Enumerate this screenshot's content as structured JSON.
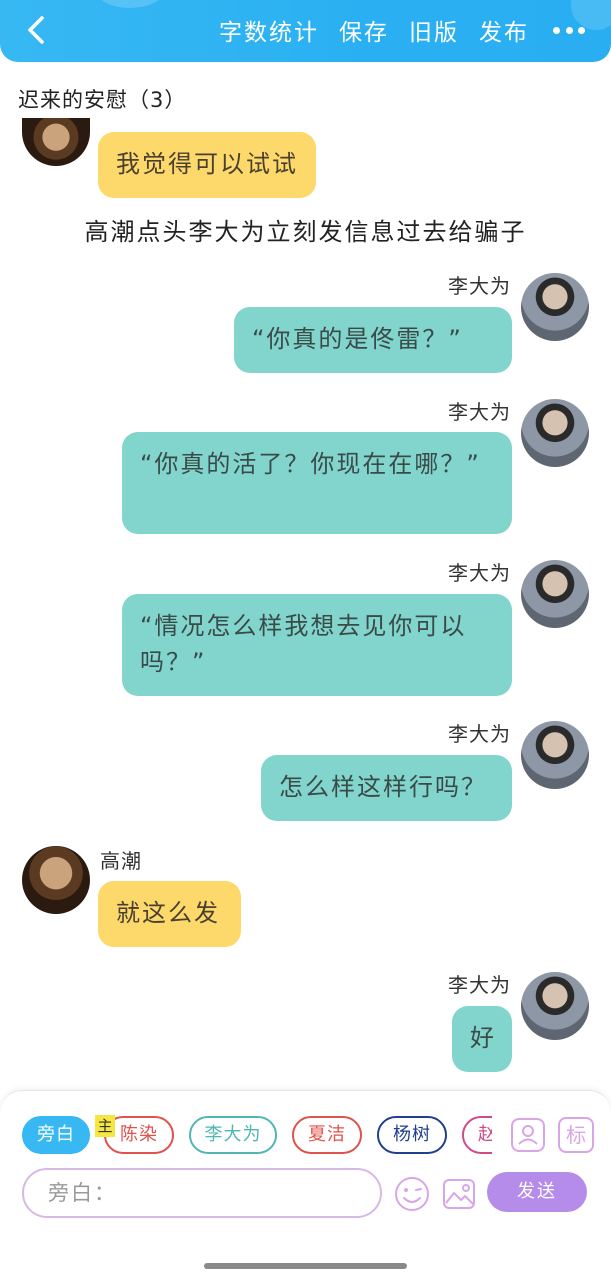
{
  "header": {
    "actions": [
      "字数统计",
      "保存",
      "旧版",
      "发布"
    ]
  },
  "story": {
    "title": "迟来的安慰（3）"
  },
  "messages": [
    {
      "speaker": "高潮",
      "text": "我觉得可以试试",
      "side": "left"
    },
    {
      "type": "narration",
      "text": "高潮点头李大为立刻发信息过去给骗子"
    },
    {
      "speaker": "李大为",
      "text": "“你真的是佟雷？”",
      "side": "right"
    },
    {
      "speaker": "李大为",
      "text": "“你真的活了？你现在在哪？”",
      "side": "right"
    },
    {
      "speaker": "李大为",
      "text": "“情况怎么样我想去见你可以吗？”",
      "side": "right"
    },
    {
      "speaker": "李大为",
      "text": "怎么样这样行吗？",
      "side": "right"
    },
    {
      "speaker": "高潮",
      "text": "就这么发",
      "side": "left"
    },
    {
      "speaker": "李大为",
      "text": "好",
      "side": "right"
    }
  ],
  "composer": {
    "main_badge": "主",
    "roles": [
      {
        "label": "旁白",
        "color": "#37b8f3",
        "active": true
      },
      {
        "label": "陈染",
        "color": "#e0524b",
        "active": false
      },
      {
        "label": "李大为",
        "color": "#4fb7b3",
        "active": false
      },
      {
        "label": "夏洁",
        "color": "#e0524b",
        "active": false
      },
      {
        "label": "杨树",
        "color": "#1f3f8f",
        "active": false
      },
      {
        "label": "赵",
        "color": "#d04a8a",
        "active": false
      }
    ],
    "input_placeholder": "旁白：",
    "send_label": "发送",
    "label_tool": "标"
  },
  "colors": {
    "header_blue": "#37b8f3",
    "bubble_teal": "#82d5cd",
    "bubble_yellow": "#fdd96b",
    "send_purple": "#b68cea"
  }
}
